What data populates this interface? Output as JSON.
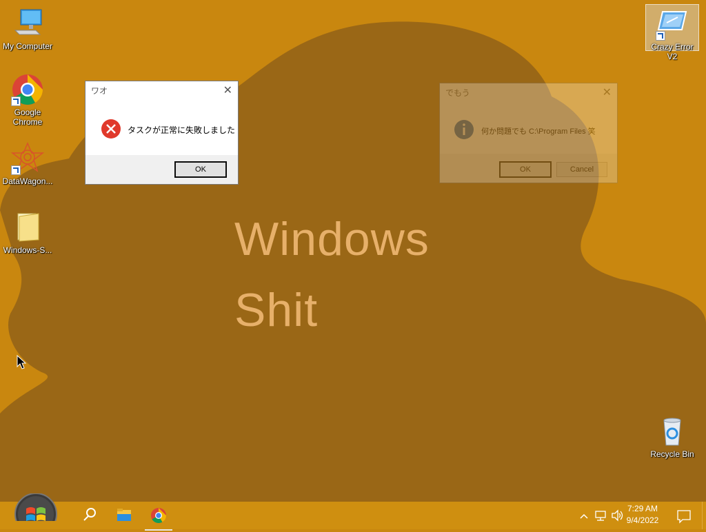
{
  "desktop": {
    "wallpaper_line1": "Windows",
    "wallpaper_line2": "Shit",
    "icons": [
      {
        "label": "My Computer"
      },
      {
        "label": "Google Chrome"
      },
      {
        "label": "DataWagon..."
      },
      {
        "label": "Windows-S..."
      },
      {
        "label": "Crazy Error V2"
      },
      {
        "label": "Recycle Bin"
      }
    ]
  },
  "error_dialog": {
    "title": "ワオ",
    "message": "タスクが正常に失敗しました",
    "ok_label": "OK"
  },
  "info_dialog": {
    "title": "でもう",
    "message": "何か問題でも C:\\Program Files 笑",
    "ok_label": "OK",
    "cancel_label": "Cancel"
  },
  "taskbar": {
    "time": "7:29 AM",
    "date": "9/4/2022"
  },
  "colors": {
    "background": "#c9870f",
    "blob": "#9a6716",
    "taskbar": "#cf8f10",
    "error_red": "#e0392b"
  }
}
